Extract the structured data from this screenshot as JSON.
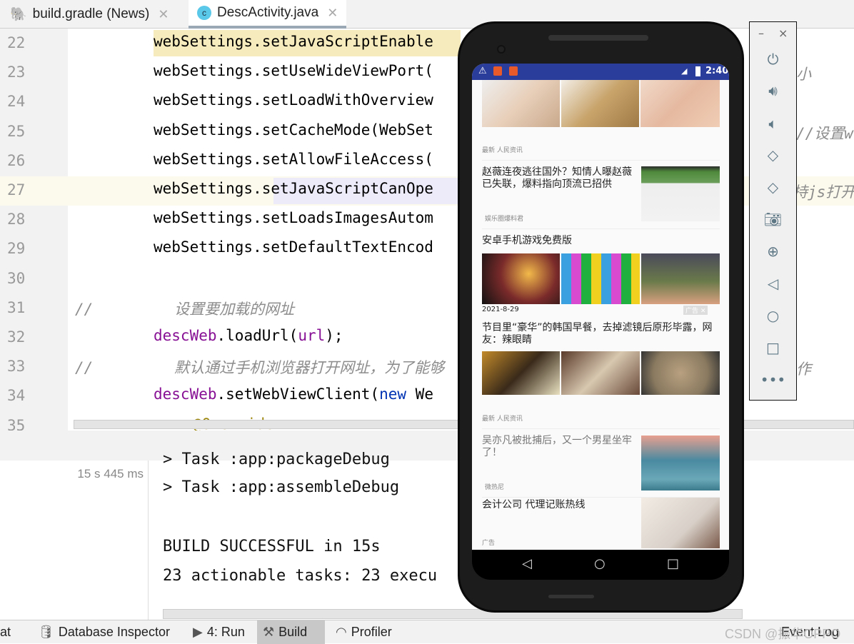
{
  "tabs": [
    {
      "label": "build.gradle (News)",
      "icon": "gradle-elephant-icon"
    },
    {
      "label": "DescActivity.java",
      "icon": "class-c-icon",
      "active": true
    }
  ],
  "editor": {
    "lines": [
      {
        "num": "22",
        "text": "webSettings.setJavaScriptEnable"
      },
      {
        "num": "23",
        "text": "webSettings.setUseWideViewPort("
      },
      {
        "num": "24",
        "text": "webSettings.setLoadWithOverview"
      },
      {
        "num": "25",
        "text": "webSettings.setCacheMode(WebSet"
      },
      {
        "num": "26",
        "text": "webSettings.setAllowFileAccess("
      },
      {
        "num": "27",
        "text": "webSettings.setJavaScriptCanOpe"
      },
      {
        "num": "28",
        "text": "webSettings.setLoadsImagesAutom"
      },
      {
        "num": "29",
        "text": "webSettings.setDefaultTextEncod"
      },
      {
        "num": "30",
        "text": ""
      },
      {
        "num": "31",
        "comment": "//",
        "text": "设置要加载的网址"
      },
      {
        "num": "32",
        "obj": "descWeb",
        "text": ".loadUrl(",
        "arg": "url",
        "end": ");"
      },
      {
        "num": "33",
        "comment": "//",
        "text": "默认通过手机浏览器打开网址，为了能够"
      },
      {
        "num": "34",
        "obj": "descWeb",
        "text": ".setWebViewClient(",
        "kw": "new",
        "end": " We"
      },
      {
        "num": "35",
        "text": "@Override"
      }
    ],
    "fragments": {
      "l23": "小",
      "l25": "//设置w",
      "l27": "持js打开",
      "l33": "作"
    }
  },
  "build": {
    "duration": "15 s 445 ms",
    "output": [
      "> Task :app:packageDebug",
      "> Task :app:assembleDebug",
      "",
      "BUILD SUCCESSFUL in 15s",
      "23 actionable tasks: 23 execu"
    ]
  },
  "bottom_bar": [
    {
      "label": "at"
    },
    {
      "label": "Database Inspector",
      "icon": "database-icon"
    },
    {
      "label": "4: Run",
      "icon": "run-icon"
    },
    {
      "label": "Build",
      "icon": "hammer-icon",
      "active": true
    },
    {
      "label": "Profiler",
      "icon": "profiler-icon"
    },
    {
      "label": "Event Log"
    }
  ],
  "watermark": "CSDN @振华OPPO",
  "phone": {
    "status_time": "2:40",
    "feed": {
      "label1": "最新  人民资讯",
      "article1": {
        "title": "赵薇连夜逃往国外？知情人曝赵薇已失联，爆料指向顶流已招供",
        "source": "娱乐圈爆料君"
      },
      "ad1": {
        "title": "安卓手机游戏免费版",
        "date": "2021-8-29",
        "ad_tag": "广告"
      },
      "article2": {
        "title": "节目里“豪华”的韩国早餐，去掉滤镜后原形毕露，网友：辣眼睛"
      },
      "label2": "最新  人民资讯",
      "article3": {
        "title": "吴亦凡被批捕后，又一个男星坐牢了！",
        "source": "微热尼"
      },
      "ad2": {
        "title": "会计公司 代理记账热线",
        "source": "广告"
      }
    }
  },
  "emulator_panel": {
    "minimize": "–",
    "close": "×",
    "buttons": [
      "power-icon",
      "volume-up-icon",
      "volume-down-icon",
      "rotate-left-icon",
      "rotate-right-icon",
      "camera-icon",
      "zoom-icon",
      "back-icon",
      "home-icon",
      "overview-icon",
      "more-icon"
    ]
  }
}
